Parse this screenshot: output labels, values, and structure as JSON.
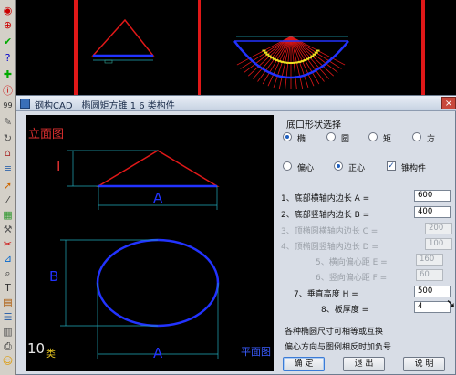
{
  "toolbar": {
    "icons": [
      "dot-icon",
      "circle-icon",
      "checkmark-icon",
      "help-icon",
      "plus-icon",
      "info-icon",
      "number-icon",
      "pencil-icon",
      "rotate-icon",
      "stamp-icon",
      "layers-icon",
      "arrow-icon",
      "line-icon",
      "grid-icon",
      "wrench-icon",
      "measure-icon",
      "ruler-icon",
      "magnify-icon",
      "text-icon",
      "block-icon",
      "list-icon",
      "table-icon",
      "print-icon",
      "color-icon",
      "smile-icon"
    ]
  },
  "dialog": {
    "title": "钢构CAD＿椭圆矩方锥 1 6 类构件",
    "close": "×"
  },
  "preview": {
    "elevation_label": "立面图",
    "plan_label": "平面图",
    "type_number": "10",
    "type_suffix": "类",
    "dim_a_top": "A",
    "dim_i": "I",
    "dim_b": "B",
    "dim_a_bottom": "A"
  },
  "form": {
    "shape_heading": "底口形状选择",
    "shape_options": [
      {
        "label": "椭",
        "selected": true
      },
      {
        "label": "圆",
        "selected": false
      },
      {
        "label": "矩",
        "selected": false
      },
      {
        "label": "方",
        "selected": false
      }
    ],
    "mode_options": [
      {
        "label": "偏心",
        "selected": false
      },
      {
        "label": "正心",
        "selected": true
      }
    ],
    "cone_label": "锥构件",
    "cone_checked": "✓",
    "fields": [
      {
        "label": "1、底部横轴内边长 A =",
        "value": "600",
        "enabled": true
      },
      {
        "label": "2、底部竖轴内边长 B =",
        "value": "400",
        "enabled": true
      },
      {
        "label": "3、顶椭圆横轴内边长 C =",
        "value": "200",
        "enabled": false
      },
      {
        "label": "4、顶椭圆竖轴内边长 D =",
        "value": "100",
        "enabled": false
      },
      {
        "label": "5、横向偏心距 E =",
        "value": "160",
        "enabled": false
      },
      {
        "label": "6、竖向偏心距 F =",
        "value": "60",
        "enabled": false
      },
      {
        "label": "7、垂直高度 H =",
        "value": "500",
        "enabled": true
      },
      {
        "label": "8、板厚度 =",
        "value": "4",
        "enabled": true
      }
    ],
    "note_1": "各种椭圆尺寸可相等或互换",
    "note_2": "偏心方向与图例相反时加负号",
    "buttons": {
      "ok": "确  定",
      "exit": "退  出",
      "help": "说  明"
    }
  },
  "colors": {
    "cad_background": "#000000",
    "red_line": "#e01818",
    "blue_line": "#2233ff",
    "yellow_marks": "#f0e020",
    "dialog_bg": "#d8dde6"
  }
}
